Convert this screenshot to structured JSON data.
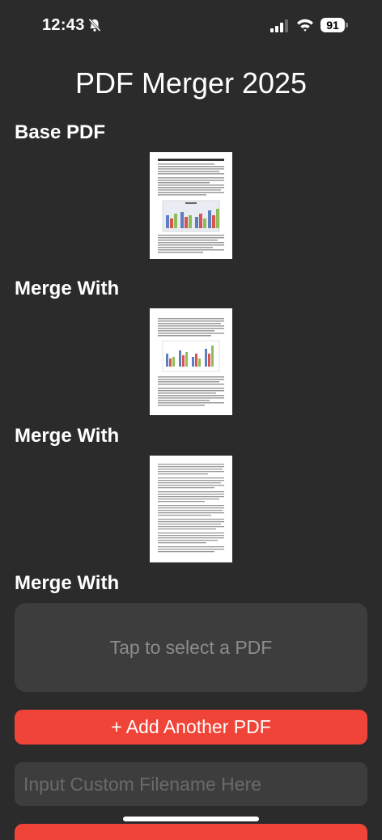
{
  "status": {
    "time": "12:43",
    "battery": "91",
    "icons": [
      "bell-slash-icon",
      "cellular-signal-icon",
      "wifi-icon",
      "battery-icon"
    ]
  },
  "title": "PDF Merger 2025",
  "sections": {
    "base": "Base PDF",
    "merge1": "Merge With",
    "merge2": "Merge With",
    "merge3": "Merge With"
  },
  "picker": {
    "label": "Tap to select a PDF"
  },
  "add_button": {
    "label": "+ Add Another PDF"
  },
  "filename": {
    "placeholder": "Input Custom Filename Here",
    "value": ""
  },
  "colors": {
    "background": "#2b2b2b",
    "accent": "#f04438",
    "card": "#3d3d3d",
    "placeholder": "#8c8c8c"
  }
}
